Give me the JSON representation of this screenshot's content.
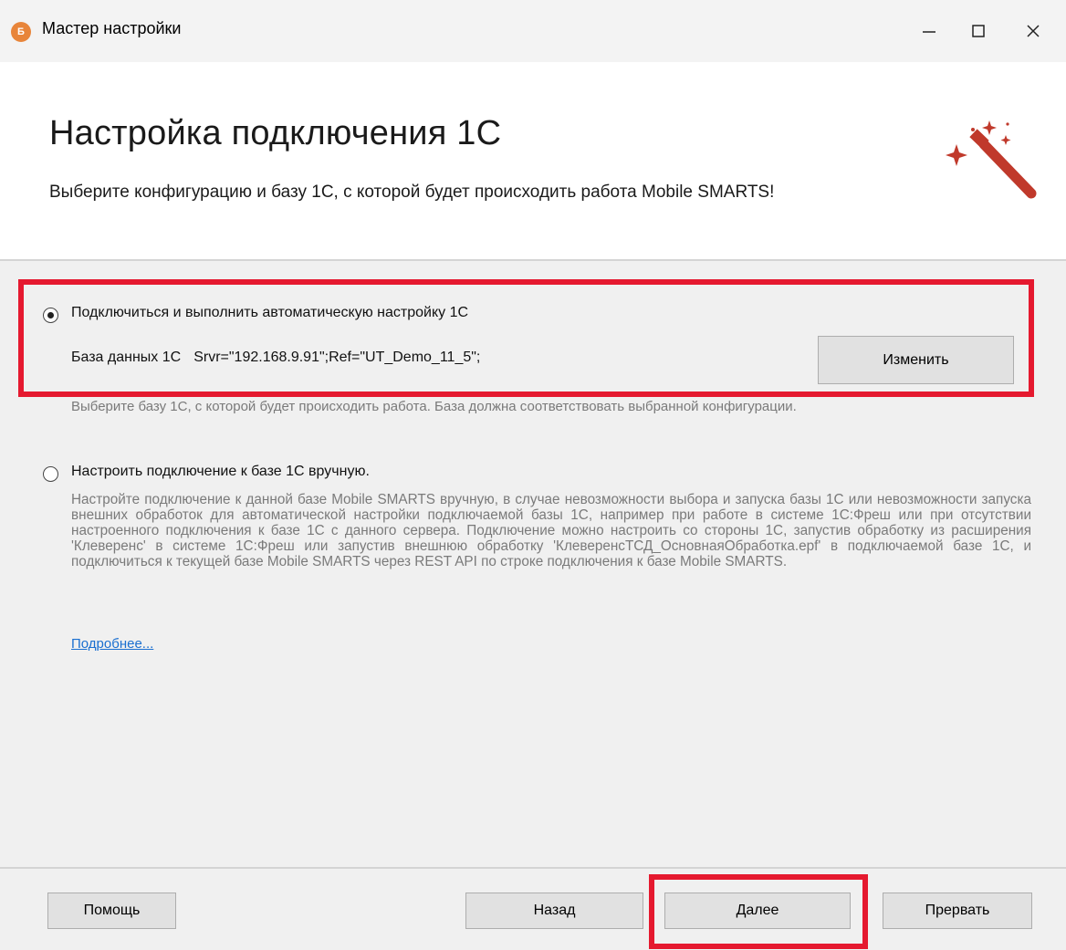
{
  "window": {
    "icon_glyph": "Б",
    "title": "Мастер настройки",
    "minimize_icon": "minimize-icon",
    "maximize_icon": "maximize-icon",
    "close_icon": "close-icon"
  },
  "header": {
    "title": "Настройка подключения 1С",
    "subtitle": "Выберите конфигурацию и базу 1С, с которой будет происходить работа Mobile SMARTS!",
    "icon": "magic-wand-icon",
    "icon_color": "#c0392b"
  },
  "options": {
    "auto": {
      "label": "Подключиться и выполнить автоматическую настройку 1С",
      "selected": true,
      "db_label": "База данных 1С",
      "db_value": "Srvr=\"192.168.9.91\";Ref=\"UT_Demo_11_5\";",
      "change_button": "Изменить",
      "hint": "Выберите базу 1С, с которой будет происходить работа. База должна  соответствовать выбранной конфигурации."
    },
    "manual": {
      "label": "Настроить подключение к базе 1С вручную.",
      "selected": false,
      "description": "Настройте подключение к данной базе Mobile SMARTS вручную, в случае невозможности выбора и запуска базы 1С или невозможности запуска внешних обработок для автоматической настройки подключаемой базы 1С, например при работе в системе 1С:Фреш или при отсутствии настроенного подключения к базе 1С с данного сервера.          Подключение можно настроить со стороны 1С, запустив обработку из расширения 'Клеверенс' в системе 1С:Фреш или запустив внешнюю обработку 'КлеверенсТСД_ОсновнаяОбработка.epf' в подключаемой базе 1С, и подключиться к текущей базе Mobile SMARTS через REST API по строке подключения к базе Mobile SMARTS.",
      "more_link": "Подробнее..."
    }
  },
  "footer": {
    "help": "Помощь",
    "back": "Назад",
    "next": "Далее",
    "cancel": "Прервать"
  },
  "highlight_color": "#e5192f"
}
